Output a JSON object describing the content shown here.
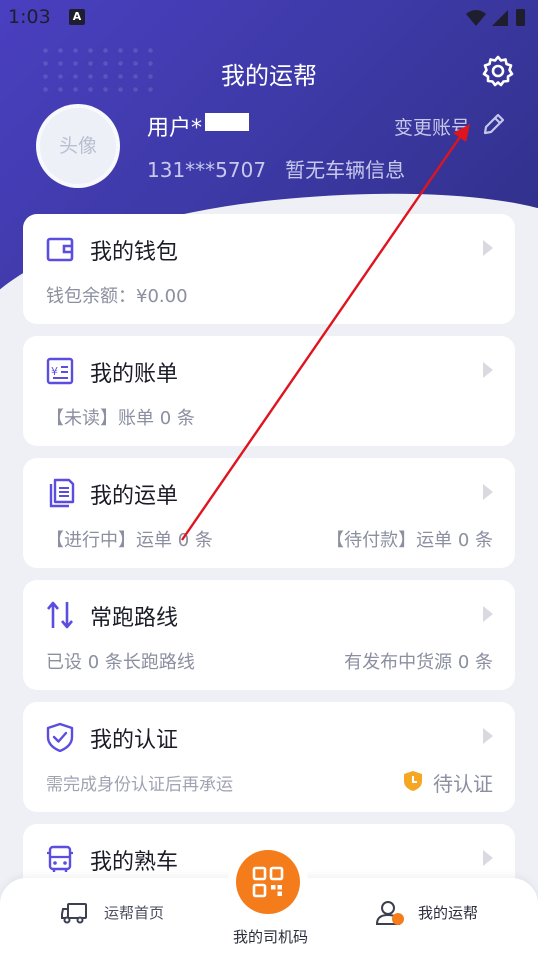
{
  "status": {
    "time": "1:03"
  },
  "header": {
    "title": "我的运帮"
  },
  "profile": {
    "avatar_text": "头像",
    "username": "用户*",
    "phone": "131***5707",
    "vehicle": "暂无车辆信息",
    "change_account": "变更账号"
  },
  "cards": {
    "wallet": {
      "title": "我的钱包",
      "sub": "钱包余额：¥0.00"
    },
    "bill": {
      "title": "我的账单",
      "sub": "【未读】账单 0 条"
    },
    "order": {
      "title": "我的运单",
      "sub_left": "【进行中】运单 0 条",
      "sub_right": "【待付款】运单 0 条"
    },
    "route": {
      "title": "常跑路线",
      "sub_left": "已设 0 条长跑路线",
      "sub_right": "有发布中货源 0 条"
    },
    "cert": {
      "title": "我的认证",
      "sub_left": "需完成身份认证后再承运",
      "status": "待认证"
    },
    "car": {
      "title": "我的熟车"
    }
  },
  "tabbar": {
    "home": "运帮首页",
    "qr": "我的司机码",
    "mine": "我的运帮"
  },
  "colors": {
    "primary": "#4a3fc0",
    "accent": "#f47c1a",
    "icon": "#5b4de0",
    "annotation": "#e0141e"
  }
}
